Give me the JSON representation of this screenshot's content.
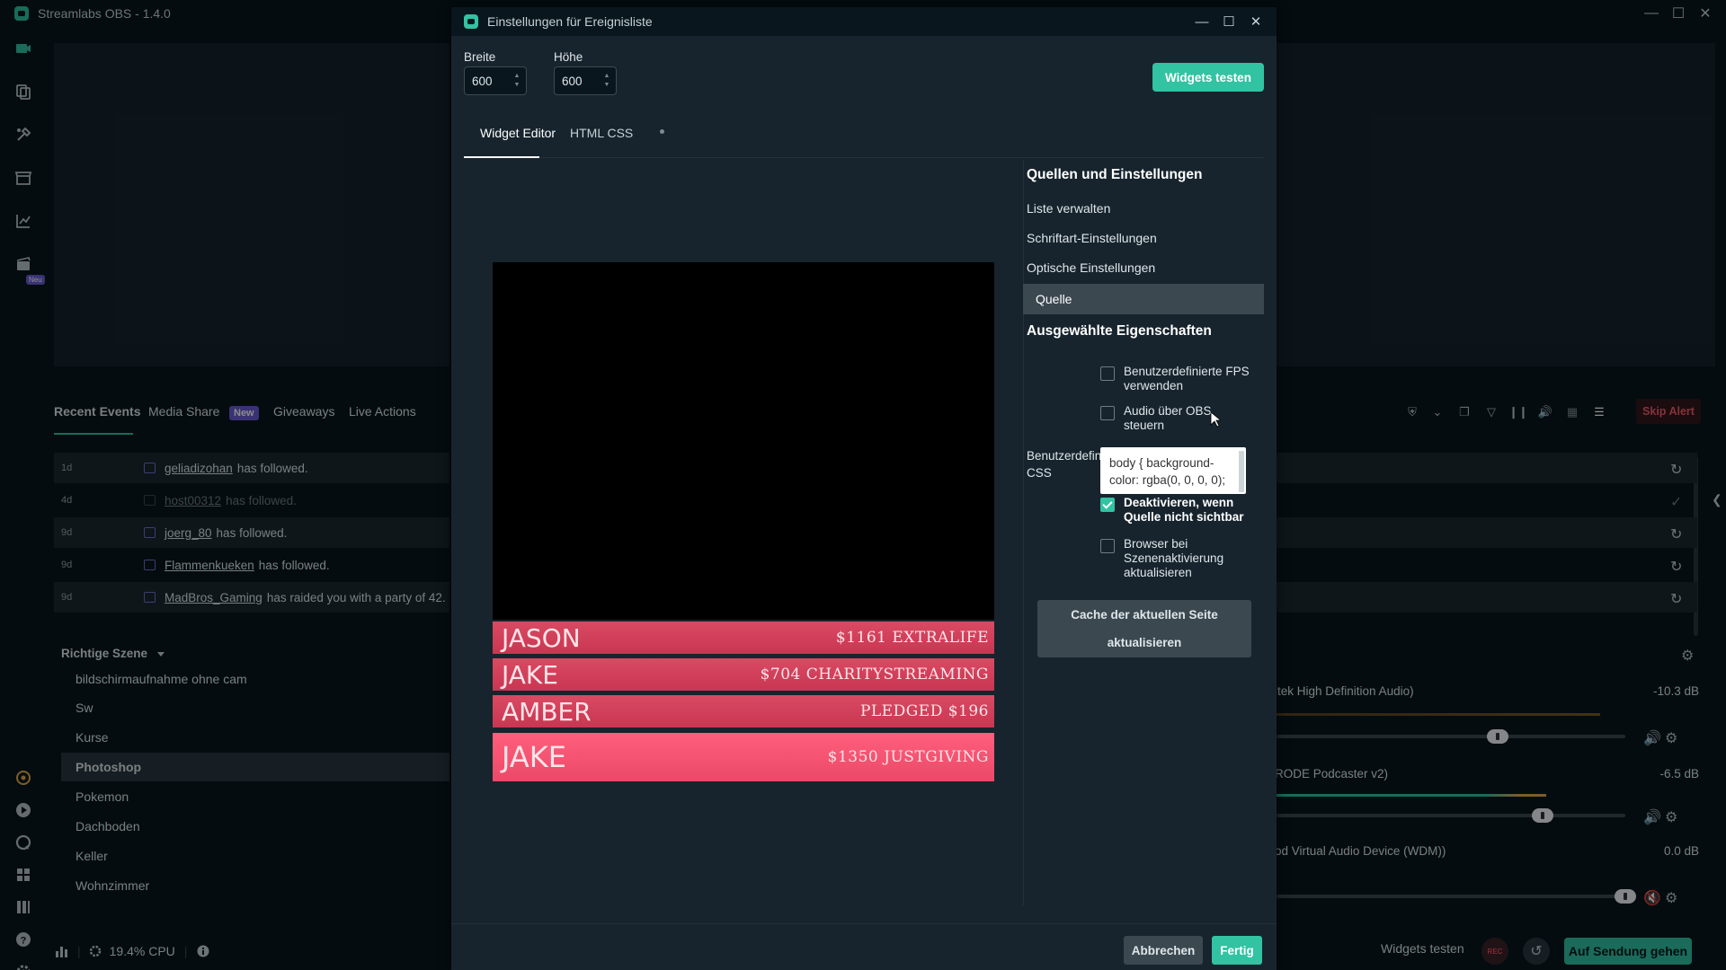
{
  "app": {
    "title": "Streamlabs OBS - 1.4.0",
    "minimize": "—",
    "maximize": "☐",
    "close": "✕"
  },
  "nav": {
    "badge_new": "Neu"
  },
  "events": {
    "tabs": [
      "Recent Events",
      "Media Share",
      "Giveaways",
      "Live Actions"
    ],
    "new_badge": "New",
    "rows": [
      {
        "time": "1d",
        "name": "geliadizohan",
        "text": "has followed."
      },
      {
        "time": "4d",
        "name": "host00312",
        "text": "has followed."
      },
      {
        "time": "9d",
        "name": "joerg_80",
        "text": "has followed."
      },
      {
        "time": "9d",
        "name": "Flammenkueken",
        "text": "has followed."
      },
      {
        "time": "9d",
        "name": "MadBros_Gaming",
        "text": "has raided you with a party of 42."
      }
    ]
  },
  "scenes": {
    "header": "Richtige Szene",
    "items": [
      "bildschirmaufnahme ohne cam",
      "Sw",
      "Kurse",
      "Photoshop",
      "Pokemon",
      "Dachboden",
      "Keller",
      "Wohnzimmer"
    ],
    "selected": "Photoshop"
  },
  "status": {
    "cpu": "19.4% CPU"
  },
  "right_dock": {
    "skip_alert": "Skip Alert",
    "mixer": [
      {
        "label": "ltek High Definition Audio)",
        "db": "-10.3 dB",
        "level": 0.58
      },
      {
        "label": "RODE Podcaster v2)",
        "db": "-6.5 dB",
        "level": 0.7
      },
      {
        "label": "od Virtual Audio Device (WDM))",
        "db": "0.0 dB",
        "level": 0.95
      }
    ],
    "widgets_test": "Widgets testen",
    "rec": "REC",
    "go_live": "Auf Sendung gehen"
  },
  "dialog": {
    "title": "Einstellungen für Ereignisliste",
    "width_label": "Breite",
    "width_value": "600",
    "height_label": "Höhe",
    "height_value": "600",
    "test_button": "Widgets testen",
    "tabs": [
      "Widget Editor",
      "HTML CSS"
    ],
    "bars": [
      {
        "name": "JASON",
        "amount": "$1161 EXTRALIFE"
      },
      {
        "name": "JAKE",
        "amount": "$704 CHARITYSTREAMING"
      },
      {
        "name": "AMBER",
        "amount": "PLEDGED $196"
      },
      {
        "name": "JAKE",
        "amount": "$1350 JUSTGIVING"
      }
    ],
    "sections": {
      "sources_heading": "Quellen und Einstellungen",
      "items": [
        "Liste verwalten",
        "Schriftart-Einstellungen",
        "Optische Einstellungen",
        "Quelle"
      ],
      "selected_heading": "Ausgewählte Eigenschaften"
    },
    "options": {
      "fps": "Benutzerdefinierte FPS verwenden",
      "audio": "Audio über OBS steuern",
      "css_label": "Benutzerdefiniertes CSS",
      "css_value": "body { background-color: rgba(0, 0, 0, 0);",
      "disable_hidden": "Deaktivieren, wenn Quelle nicht sichtbar",
      "refresh_scene": "Browser bei Szenenaktivierung aktualisieren"
    },
    "cache_button_line1": "Cache der aktuellen Seite",
    "cache_button_line2": "aktualisieren",
    "cancel": "Abbrechen",
    "done": "Fertig"
  },
  "colors": {
    "accent": "#31c3a2",
    "bar_red": "#d94a63",
    "bar_highlight": "#ff5f7c",
    "purple": "#6b5bd6",
    "background": "#09161d",
    "panel": "#17242d"
  }
}
